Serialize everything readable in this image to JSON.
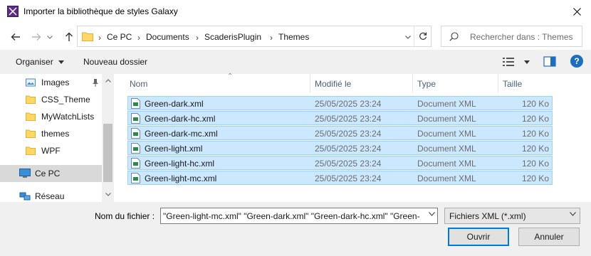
{
  "window": {
    "title": "Importer la bibliothèque de styles Galaxy"
  },
  "address": {
    "crumbs": [
      "Ce PC",
      "Documents",
      "ScaderisPlugin",
      "Themes"
    ]
  },
  "search": {
    "placeholder": "Rechercher dans : Themes"
  },
  "toolbar": {
    "organize_label": "Organiser",
    "new_folder_label": "Nouveau dossier",
    "help_label": "?"
  },
  "sidebar": {
    "items": [
      {
        "label": "Images",
        "icon": "images-folder-icon"
      },
      {
        "label": "CSS_Theme",
        "icon": "folder-icon"
      },
      {
        "label": "MyWatchLists",
        "icon": "folder-icon"
      },
      {
        "label": "themes",
        "icon": "folder-icon"
      },
      {
        "label": "WPF",
        "icon": "folder-icon"
      },
      {
        "label": "Ce PC",
        "icon": "computer-icon"
      },
      {
        "label": "Réseau",
        "icon": "network-icon"
      }
    ]
  },
  "columns": {
    "name": "Nom",
    "modified": "Modifié le",
    "type": "Type",
    "size": "Taille"
  },
  "files": [
    {
      "name": "Green-dark.xml",
      "modified": "25/05/2025 23:24",
      "type": "Document XML",
      "size": "120 Ko"
    },
    {
      "name": "Green-dark-hc.xml",
      "modified": "25/05/2025 23:24",
      "type": "Document XML",
      "size": "120 Ko"
    },
    {
      "name": "Green-dark-mc.xml",
      "modified": "25/05/2025 23:24",
      "type": "Document XML",
      "size": "120 Ko"
    },
    {
      "name": "Green-light.xml",
      "modified": "25/05/2025 23:24",
      "type": "Document XML",
      "size": "120 Ko"
    },
    {
      "name": "Green-light-hc.xml",
      "modified": "25/05/2025 23:24",
      "type": "Document XML",
      "size": "120 Ko"
    },
    {
      "name": "Green-light-mc.xml",
      "modified": "25/05/2025 23:24",
      "type": "Document XML",
      "size": "120 Ko"
    }
  ],
  "bottom": {
    "filename_label": "Nom du fichier :",
    "filename_value": "\"Green-light-mc.xml\" \"Green-dark.xml\" \"Green-dark-hc.xml\" \"Green-",
    "filetype_value": "Fichiers XML (*.xml)",
    "open_label": "Ouvrir",
    "cancel_label": "Annuler"
  },
  "colors": {
    "selection_bg": "#cce8ff",
    "selection_border": "#99d1ff",
    "accent": "#0078d7"
  }
}
